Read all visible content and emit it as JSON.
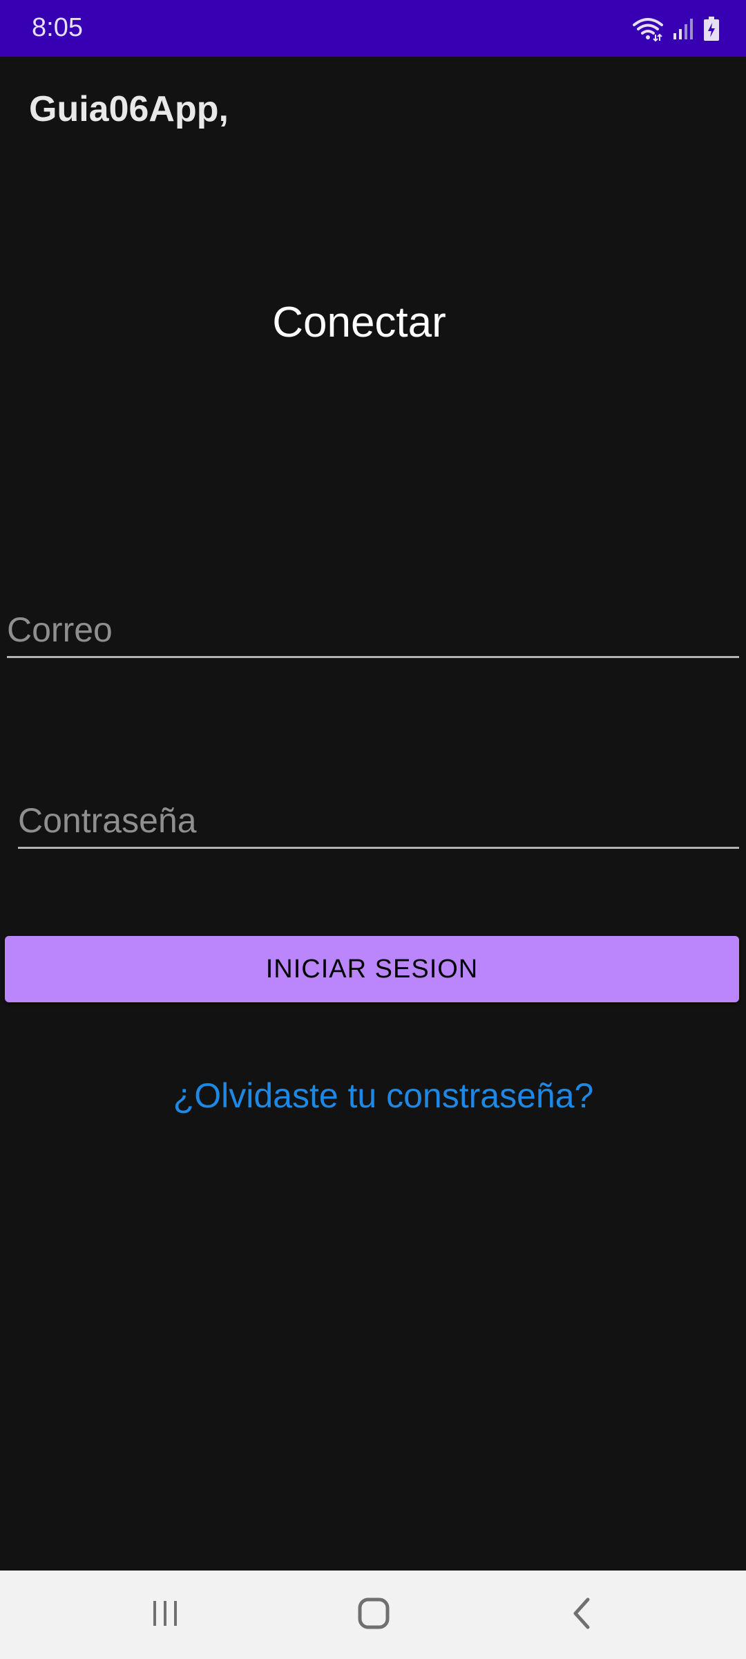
{
  "status_bar": {
    "time": "8:05",
    "icons": [
      "wifi-icon",
      "signal-icon",
      "battery-charging-icon"
    ],
    "color": "#3700B3"
  },
  "app": {
    "title": "Guia06App,"
  },
  "login": {
    "heading": "Conectar",
    "email_placeholder": "Correo",
    "password_placeholder": "Contraseña",
    "button_label": "INICIAR SESION",
    "forgot_label": "¿Olvidaste tu constraseña?",
    "accent_color": "#BB86FC",
    "link_color": "#1E88E5"
  },
  "nav_bar": {
    "icons": [
      "recent-apps-icon",
      "home-icon",
      "back-icon"
    ]
  }
}
